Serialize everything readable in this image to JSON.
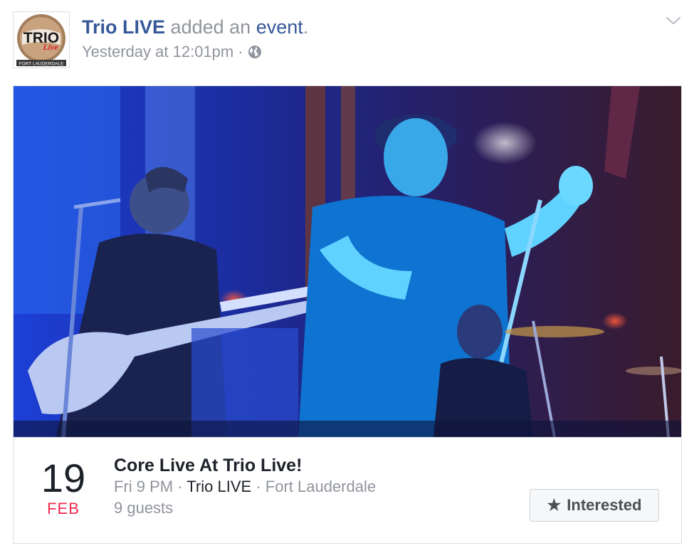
{
  "post": {
    "page_name": "Trio LIVE",
    "action_text": "added an",
    "object_text": "event",
    "punctuation": ".",
    "timestamp": "Yesterday at 12:01pm",
    "separator": "·",
    "audience_icon": "globe-icon",
    "menu_icon": "chevron-down-icon",
    "avatar": {
      "logo_text_top": "TRIO",
      "logo_text_mid": "Live",
      "logo_text_bottom": "FORT LAUDERDALE"
    }
  },
  "event": {
    "day": "19",
    "month": "FEB",
    "title": "Core Live At Trio Live!",
    "time": "Fri 9 PM",
    "host": "Trio LIVE",
    "location": "Fort Lauderdale",
    "guests": "9 guests",
    "interested_label": "Interested",
    "interested_icon": "star-icon"
  },
  "colors": {
    "link": "#365899",
    "meta": "#90949c",
    "month_red": "#f0284a",
    "text": "#1d2129"
  }
}
